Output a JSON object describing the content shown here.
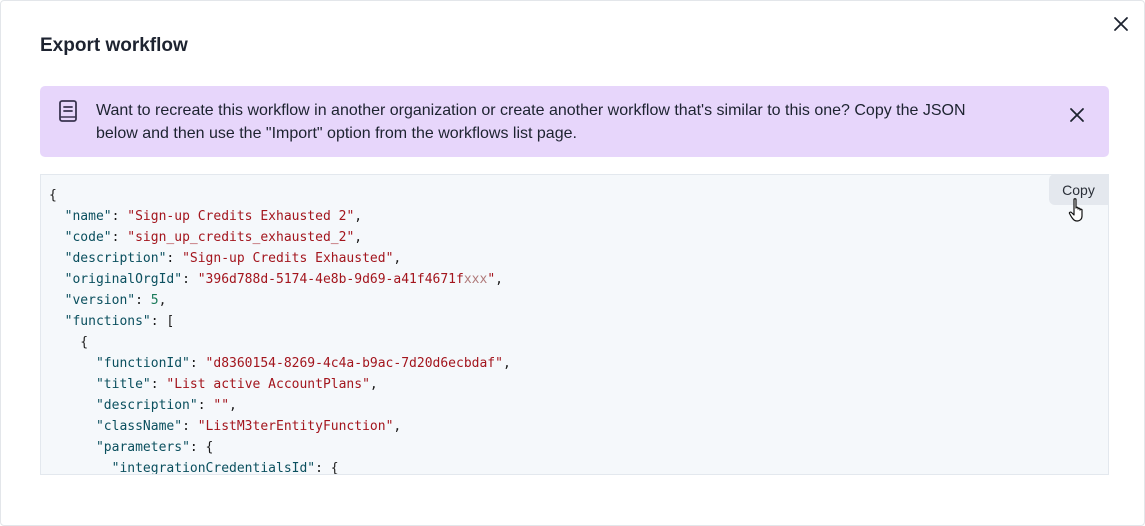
{
  "dialog": {
    "title": "Export workflow",
    "close_icon": "close-icon"
  },
  "banner": {
    "icon": "book-icon",
    "line1": "Want to recreate this workflow in another organization or create another workflow that's similar to this one? Copy the JSON",
    "line2": "below and then use the \"Import\" option from the workflows list page.",
    "close_icon": "close-icon"
  },
  "copy_button": {
    "label": "Copy"
  },
  "json_preview": {
    "name": "Sign-up Credits Exhausted 2",
    "code": "sign_up_credits_exhausted_2",
    "description": "Sign-up Credits Exhausted",
    "originalOrgId": "396d788d-5174-4e8b-9d69-a41f4671f",
    "originalOrgId_masked": "xxx",
    "version": "5",
    "functions": {
      "functionId": "d8360154-8269-4c4a-b9ac-7d20d6ecbdaf",
      "title": "List active AccountPlans",
      "description": "",
      "className": "ListM3terEntityFunction",
      "parameters_key": "parameters",
      "credentials_key": "integrationCredentialsId"
    }
  },
  "colors": {
    "banner_bg": "#e7d6fb",
    "code_bg": "#f5f8fb",
    "json_key": "#0a4f5e",
    "json_string": "#a3151d",
    "json_number": "#1a7a5a"
  }
}
